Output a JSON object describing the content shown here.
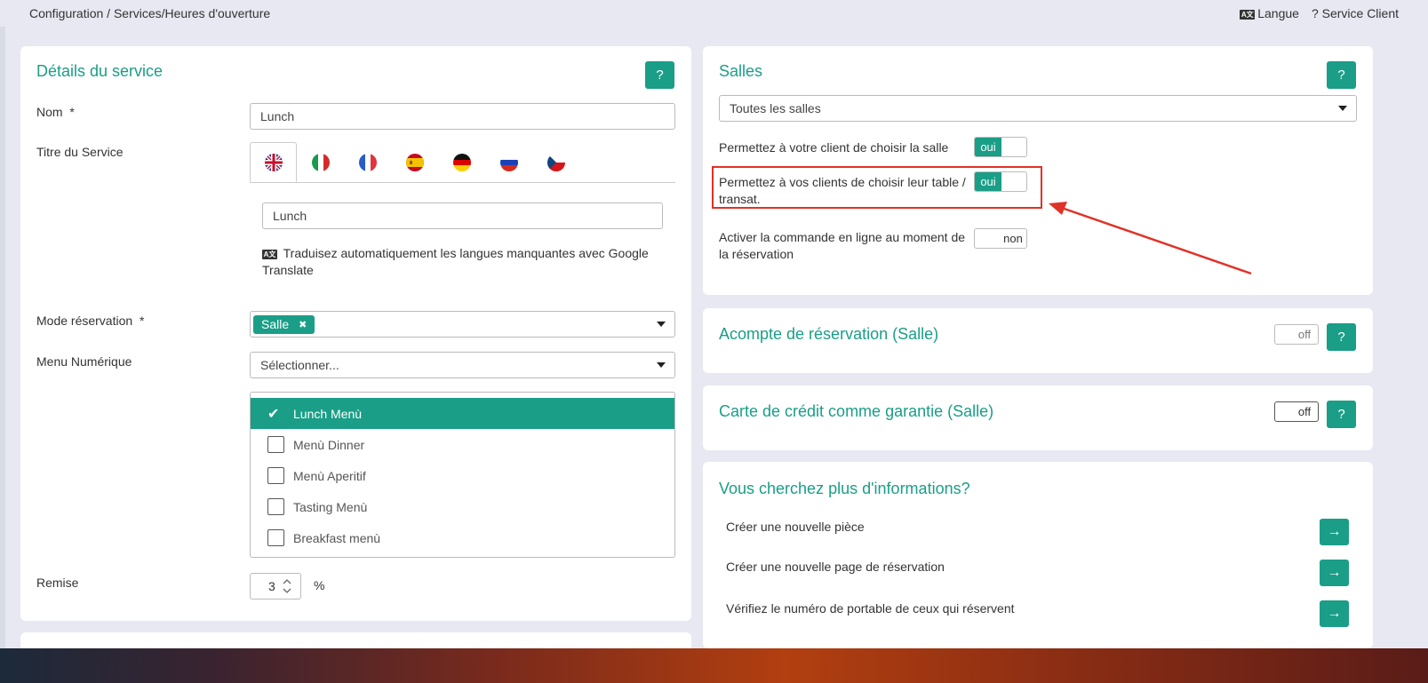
{
  "header": {
    "breadcrumb": "Configuration / Services/Heures d'ouverture",
    "language_label": "Langue",
    "language_icon": "language-icon",
    "support_label": "Service Client",
    "support_icon": "?"
  },
  "colors": {
    "accent": "#1a9e87",
    "highlight": "#e03228",
    "background": "#e7e8f1"
  },
  "service_details": {
    "title": "Détails du service",
    "help": "?",
    "name_label": "Nom",
    "required_mark": "*",
    "name_value": "Lunch",
    "service_title_label": "Titre du Service",
    "language_tabs": [
      "english-flag",
      "italian-flag",
      "french-flag",
      "spanish-flag",
      "german-flag",
      "russian-flag",
      "czech-flag"
    ],
    "service_title_value": "Lunch",
    "translate_note": "Traduisez automatiquement les langues manquantes avec Google Translate",
    "booking_mode_label": "Mode réservation",
    "booking_mode_tag": "Salle",
    "tag_remove": "✖",
    "digital_menu_label": "Menu Numérique",
    "digital_menu_placeholder": "Sélectionner...",
    "menu_items": [
      {
        "label": "Lunch Menù",
        "checked": true
      },
      {
        "label": "Menù Dinner",
        "checked": false
      },
      {
        "label": "Menù Aperitif",
        "checked": false
      },
      {
        "label": "Tasting Menù",
        "checked": false
      },
      {
        "label": "Breakfast menù",
        "checked": false
      }
    ],
    "checkmark": "✔",
    "discount_label": "Remise",
    "discount_value": "3",
    "discount_unit": "%"
  },
  "rooms": {
    "title": "Salles",
    "help": "?",
    "select_value": "Toutes les salles",
    "choose_room_label": "Permettez à votre client de choisir la salle",
    "choose_room_toggle": "oui",
    "choose_table_label": "Permettez à vos clients de choisir leur table / transat.",
    "choose_table_toggle": "oui",
    "online_order_label": "Activer la commande en ligne au moment de la réservation",
    "online_order_toggle": "non"
  },
  "deposit": {
    "title": "Acompte de réservation (Salle)",
    "toggle": "off",
    "help": "?"
  },
  "credit_card": {
    "title": "Carte de crédit comme garantie (Salle)",
    "toggle": "off",
    "help": "?"
  },
  "more_info": {
    "title": "Vous cherchez plus d'informations?",
    "links": [
      "Créer une nouvelle pièce",
      "Créer une nouvelle page de réservation",
      "Vérifiez le numéro de portable de ceux qui réservent"
    ],
    "arrow": "→"
  }
}
